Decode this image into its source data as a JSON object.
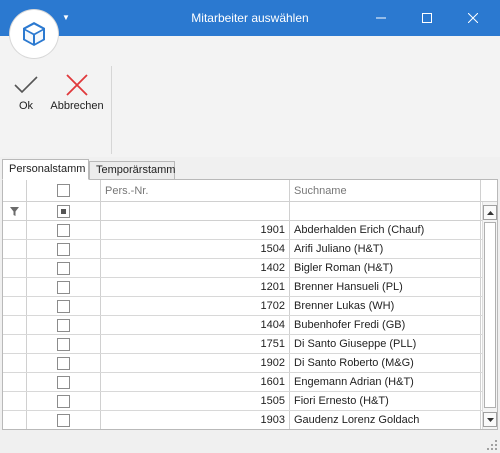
{
  "window": {
    "title": "Mitarbeiter auswählen",
    "logo_icon": "cube-icon",
    "qat_icon": "dropdown-caret-icon",
    "controls": [
      "minimize-icon",
      "maximize-icon",
      "close-icon"
    ],
    "accent_color": "#2b79d0"
  },
  "ribbon": {
    "ok_label": "Ok",
    "cancel_label": "Abbrechen",
    "ok_icon": "checkmark-icon",
    "cancel_icon": "x-cross-icon",
    "cancel_color": "#e0383b"
  },
  "tabs": [
    {
      "label": "Personalstamm",
      "active": true
    },
    {
      "label": "Temporärstamm",
      "active": false
    }
  ],
  "grid": {
    "columns": {
      "nr": "Pers.-Nr.",
      "name": "Suchname"
    },
    "filter_icon": "filter-icon",
    "rows": [
      {
        "nr": "1901",
        "name": "Abderhalden Erich (Chauf)"
      },
      {
        "nr": "1504",
        "name": "Arifi Juliano (H&T)"
      },
      {
        "nr": "1402",
        "name": "Bigler Roman (H&T)"
      },
      {
        "nr": "1201",
        "name": "Brenner Hansueli (PL)"
      },
      {
        "nr": "1702",
        "name": "Brenner Lukas (WH)"
      },
      {
        "nr": "1404",
        "name": "Bubenhofer Fredi (GB)"
      },
      {
        "nr": "1751",
        "name": "Di Santo Giuseppe (PLL)"
      },
      {
        "nr": "1902",
        "name": "Di Santo Roberto (M&G)"
      },
      {
        "nr": "1601",
        "name": "Engemann Adrian (H&T)"
      },
      {
        "nr": "1505",
        "name": "Fiori Ernesto (H&T)"
      },
      {
        "nr": "1903",
        "name": "Gaudenz Lorenz Goldach"
      }
    ]
  }
}
